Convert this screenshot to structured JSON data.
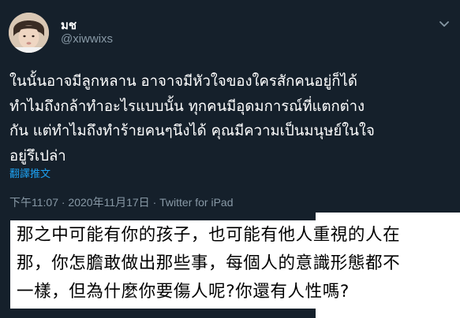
{
  "author": {
    "display_name": "มช",
    "handle": "@xiwwixs"
  },
  "tweet": {
    "lines": [
      "ในนั้นอาจมีลูกหลาน อาจาจมีหัวใจของใครสักคนอยู่ก็ได้",
      "ทำไมถึงกล้าทำอะไรแบบนั้น ทุกคนมีอุดมการณ์ที่แตกต่าง",
      "กัน แต่ทำไมถึงทำร้ายคนๆนึงได้ คุณมีความเป็นมนุษย์ในใจ",
      "อยู่รึเปล่า"
    ],
    "translate_label": "翻譯推文",
    "timestamp": "下午11:07 · 2020年11月17日",
    "separator": " · ",
    "source": "Twitter for iPad"
  },
  "translation_overlay": {
    "lines": [
      "那之中可能有你的孩子，也可能有他人重視的人在",
      "那，你怎膽敢做出那些事，每個人的意識形態都不",
      "一樣，但為什麼你要傷人呢?你還有人性嗎?"
    ]
  },
  "icons": {
    "more": "chevron-down-icon"
  },
  "colors": {
    "background": "#15202b",
    "primary_text": "#ffffff",
    "secondary_text": "#8899a6",
    "link": "#1da1f2",
    "overlay_bg": "#ffffff",
    "overlay_text": "#000000"
  }
}
